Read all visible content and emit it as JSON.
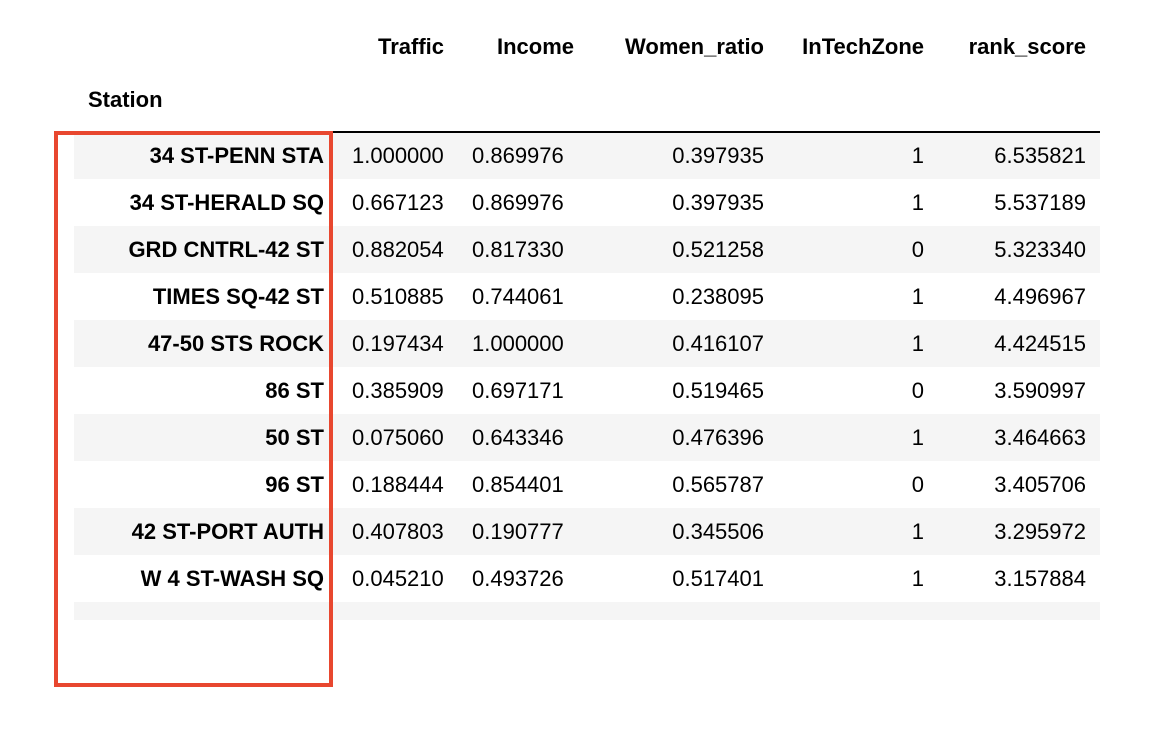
{
  "table": {
    "columns": [
      "Traffic",
      "Income",
      "Women_ratio",
      "InTechZone",
      "rank_score"
    ],
    "index_name": "Station",
    "rows": [
      {
        "station": "34 ST-PENN STA",
        "traffic": "1.000000",
        "income": "0.869976",
        "women_ratio": "0.397935",
        "intechzone": "1",
        "rank_score": "6.535821"
      },
      {
        "station": "34 ST-HERALD SQ",
        "traffic": "0.667123",
        "income": "0.869976",
        "women_ratio": "0.397935",
        "intechzone": "1",
        "rank_score": "5.537189"
      },
      {
        "station": "GRD CNTRL-42 ST",
        "traffic": "0.882054",
        "income": "0.817330",
        "women_ratio": "0.521258",
        "intechzone": "0",
        "rank_score": "5.323340"
      },
      {
        "station": "TIMES SQ-42 ST",
        "traffic": "0.510885",
        "income": "0.744061",
        "women_ratio": "0.238095",
        "intechzone": "1",
        "rank_score": "4.496967"
      },
      {
        "station": "47-50 STS ROCK",
        "traffic": "0.197434",
        "income": "1.000000",
        "women_ratio": "0.416107",
        "intechzone": "1",
        "rank_score": "4.424515"
      },
      {
        "station": "86 ST",
        "traffic": "0.385909",
        "income": "0.697171",
        "women_ratio": "0.519465",
        "intechzone": "0",
        "rank_score": "3.590997"
      },
      {
        "station": "50 ST",
        "traffic": "0.075060",
        "income": "0.643346",
        "women_ratio": "0.476396",
        "intechzone": "1",
        "rank_score": "3.464663"
      },
      {
        "station": "96 ST",
        "traffic": "0.188444",
        "income": "0.854401",
        "women_ratio": "0.565787",
        "intechzone": "0",
        "rank_score": "3.405706"
      },
      {
        "station": "42 ST-PORT AUTH",
        "traffic": "0.407803",
        "income": "0.190777",
        "women_ratio": "0.345506",
        "intechzone": "1",
        "rank_score": "3.295972"
      },
      {
        "station": "W 4 ST-WASH SQ",
        "traffic": "0.045210",
        "income": "0.493726",
        "women_ratio": "0.517401",
        "intechzone": "1",
        "rank_score": "3.157884"
      }
    ]
  },
  "highlight": {
    "color": "#e8472f"
  },
  "colors": {
    "stripe": "#f5f5f5",
    "header_rule": "#000000"
  }
}
